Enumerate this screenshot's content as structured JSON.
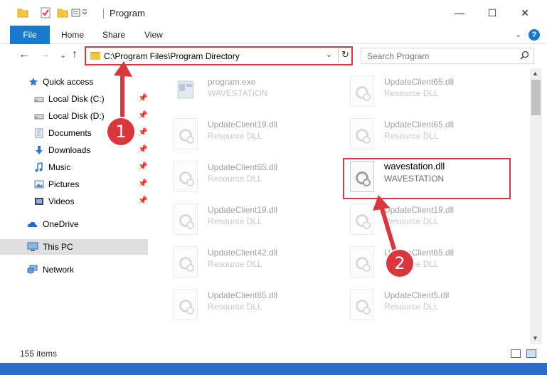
{
  "window": {
    "title": "Program",
    "minimize_glyph": "—",
    "maximize_glyph": "☐",
    "close_glyph": "✕"
  },
  "ribbon": {
    "tabs": [
      "File",
      "Home",
      "Share",
      "View"
    ],
    "expand_glyph": "⌄",
    "help_glyph": "?"
  },
  "nav": {
    "back_glyph": "←",
    "forward_glyph": "→",
    "history_glyph": "⌄",
    "up_glyph": "↑",
    "address": "C:\\Program Files\\Program Directory",
    "address_dropdown_glyph": "⌄",
    "refresh_glyph": "↻",
    "search_placeholder": "Search Program",
    "search_glyph": "⌕"
  },
  "sidebar": {
    "items": [
      {
        "label": "Quick access",
        "icon": "star-icon",
        "pinned": false
      },
      {
        "label": "Local Disk (C:)",
        "icon": "drive-icon",
        "pinned": true
      },
      {
        "label": "Local Disk (D:)",
        "icon": "drive-icon",
        "pinned": true
      },
      {
        "label": "Documents",
        "icon": "documents-icon",
        "pinned": true
      },
      {
        "label": "Downloads",
        "icon": "download-icon",
        "pinned": true
      },
      {
        "label": "Music",
        "icon": "music-icon",
        "pinned": true
      },
      {
        "label": "Pictures",
        "icon": "pictures-icon",
        "pinned": true
      },
      {
        "label": "Videos",
        "icon": "videos-icon",
        "pinned": true
      },
      {
        "label": "OneDrive",
        "icon": "cloud-icon",
        "pinned": false
      },
      {
        "label": "This PC",
        "icon": "computer-icon",
        "pinned": false,
        "selected": true
      },
      {
        "label": "Network",
        "icon": "network-icon",
        "pinned": false
      }
    ],
    "pin_glyph": "📌"
  },
  "files": [
    {
      "name": "program.exe",
      "type": "WAVESTATION",
      "faded": true
    },
    {
      "name": "UpdateClient65.dll",
      "type": "Resource DLL",
      "faded": true
    },
    {
      "name": "UpdateClient19.dll",
      "type": "Resource DLL",
      "faded": true
    },
    {
      "name": "UpdateClient65.dll",
      "type": "Resource DLL",
      "faded": true
    },
    {
      "name": "UpdateClient65.dll",
      "type": "Resource DLL",
      "faded": true
    },
    {
      "name": "wavestation.dll",
      "type": "WAVESTATION",
      "faded": false
    },
    {
      "name": "UpdateClient19.dll",
      "type": "Resource DLL",
      "faded": true
    },
    {
      "name": "UpdateClient19.dll",
      "type": "Resource DLL",
      "faded": true
    },
    {
      "name": "UpdateClient42.dll",
      "type": "Resource DLL",
      "faded": true
    },
    {
      "name": "UpdateClient65.dll",
      "type": "Resource DLL",
      "faded": true
    },
    {
      "name": "UpdateClient65.dll",
      "type": "Resource DLL",
      "faded": true
    },
    {
      "name": "UpdateClient5.dll",
      "type": "Resource DLL",
      "faded": true
    }
  ],
  "status": {
    "item_count": "155 items"
  },
  "annotations": {
    "step1": "1",
    "step2": "2",
    "color": "#d9363e"
  },
  "colors": {
    "accent": "#1979ca",
    "highlight": "#d9363e",
    "taskbar": "#2a6cc9"
  }
}
